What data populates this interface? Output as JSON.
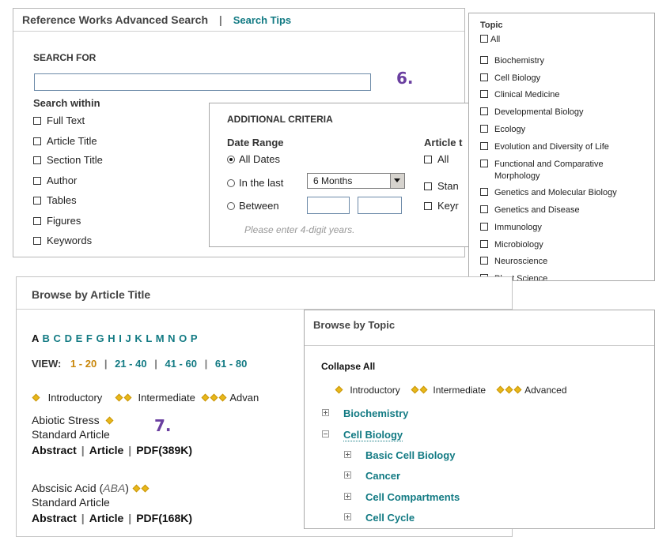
{
  "advanced": {
    "title": "Reference Works Advanced Search",
    "divider": "|",
    "tips_link": "Search Tips",
    "search_for_label": "SEARCH FOR",
    "search_input_value": "",
    "callout": "6.",
    "search_within_label": "Search within",
    "search_within": [
      "Full Text",
      "Article Title",
      "Section Title",
      "Author",
      "Tables",
      "Figures",
      "Keywords"
    ]
  },
  "criteria": {
    "title": "ADDITIONAL CRITERIA",
    "date_range_label": "Date Range",
    "all_dates": "All Dates",
    "in_the_last": "In the last",
    "period_value": "6 Months",
    "between": "Between",
    "from_value": "",
    "to_value": "",
    "hint": "Please enter 4-digit years.",
    "article_type_label": "Article t",
    "article_all": "All",
    "article_standard": "Stan",
    "article_keyr": "Keyr"
  },
  "topic_panel": {
    "title": "Topic",
    "all": "All",
    "items": [
      "Biochemistry",
      "Cell Biology",
      "Clinical Medicine",
      "Developmental Biology",
      "Ecology",
      "Evolution and Diversity of Life",
      "Functional and Comparative",
      "Genetics and Molecular Biology",
      "Genetics and Disease",
      "Immunology",
      "Microbiology",
      "Neuroscience",
      "Plant Science"
    ],
    "item_6_line2": "Morphology"
  },
  "browse_title": {
    "title": "Browse by Article Title",
    "letters": [
      "A",
      "B",
      "C",
      "D",
      "E",
      "F",
      "G",
      "H",
      "I",
      "J",
      "K",
      "L",
      "M",
      "N",
      "O",
      "P"
    ],
    "view_label": "VIEW:",
    "ranges": [
      "1 - 20",
      "21 - 40",
      "41 - 60",
      "61 - 80"
    ],
    "legend": [
      "Introductory",
      "Intermediate",
      "Advan"
    ],
    "callout": "7.",
    "articles": [
      {
        "title": "Abiotic Stress",
        "abbr": "",
        "type": "Standard Article",
        "abstract": "Abstract",
        "article": "Article",
        "pdf": "PDF(389K)"
      },
      {
        "title": "Abscisic Acid",
        "abbr": "ABA",
        "type": "Standard Article",
        "abstract": "Abstract",
        "article": "Article",
        "pdf": "PDF(168K)"
      }
    ],
    "sep": "|"
  },
  "browse_topic": {
    "title": "Browse by Topic",
    "collapse_all": "Collapse All",
    "legend": [
      "Introductory",
      "Intermediate",
      "Advanced"
    ],
    "tree": [
      {
        "label": "Biochemistry",
        "level": 0,
        "expanded": false
      },
      {
        "label": "Cell Biology",
        "level": 0,
        "expanded": true
      },
      {
        "label": "Basic Cell Biology",
        "level": 1,
        "expanded": false
      },
      {
        "label": "Cancer",
        "level": 1,
        "expanded": false
      },
      {
        "label": "Cell Compartments",
        "level": 1,
        "expanded": false
      },
      {
        "label": "Cell Cycle",
        "level": 1,
        "expanded": false
      }
    ]
  },
  "colors": {
    "teal": "#127a83",
    "callout": "#6a3fa0",
    "diamond": "#e8b81a",
    "active_range": "#c8860a"
  }
}
